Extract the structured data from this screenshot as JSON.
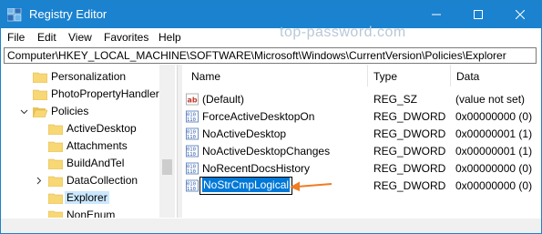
{
  "window": {
    "title": "Registry Editor",
    "watermark": "top-password.com"
  },
  "menu": [
    "File",
    "Edit",
    "View",
    "Favorites",
    "Help"
  ],
  "address": "Computer\\HKEY_LOCAL_MACHINE\\SOFTWARE\\Microsoft\\Windows\\CurrentVersion\\Policies\\Explorer",
  "tree": [
    {
      "label": "Personalization"
    },
    {
      "label": "PhotoPropertyHandler"
    },
    {
      "label": "Policies"
    },
    {
      "label": "ActiveDesktop"
    },
    {
      "label": "Attachments"
    },
    {
      "label": "BuildAndTel"
    },
    {
      "label": "DataCollection"
    },
    {
      "label": "Explorer"
    },
    {
      "label": "NonEnum"
    }
  ],
  "columns": {
    "name": "Name",
    "type": "Type",
    "data": "Data"
  },
  "rows": [
    {
      "name": "(Default)",
      "type": "REG_SZ",
      "data": "(value not set)",
      "icon": "string-value-icon"
    },
    {
      "name": "ForceActiveDesktopOn",
      "type": "REG_DWORD",
      "data": "0x00000000 (0)",
      "icon": "dword-value-icon"
    },
    {
      "name": "NoActiveDesktop",
      "type": "REG_DWORD",
      "data": "0x00000001 (1)",
      "icon": "dword-value-icon"
    },
    {
      "name": "NoActiveDesktopChanges",
      "type": "REG_DWORD",
      "data": "0x00000001 (1)",
      "icon": "dword-value-icon"
    },
    {
      "name": "NoRecentDocsHistory",
      "type": "REG_DWORD",
      "data": "0x00000000 (0)",
      "icon": "dword-value-icon"
    },
    {
      "name": "NoStrCmpLogical",
      "type": "REG_DWORD",
      "data": "0x00000000 (0)",
      "icon": "dword-value-icon"
    }
  ],
  "colors": {
    "titlebar": "#1b82cf",
    "selection": "#0078d7",
    "folder": "#f8d775",
    "arrow": "#f07c24"
  }
}
